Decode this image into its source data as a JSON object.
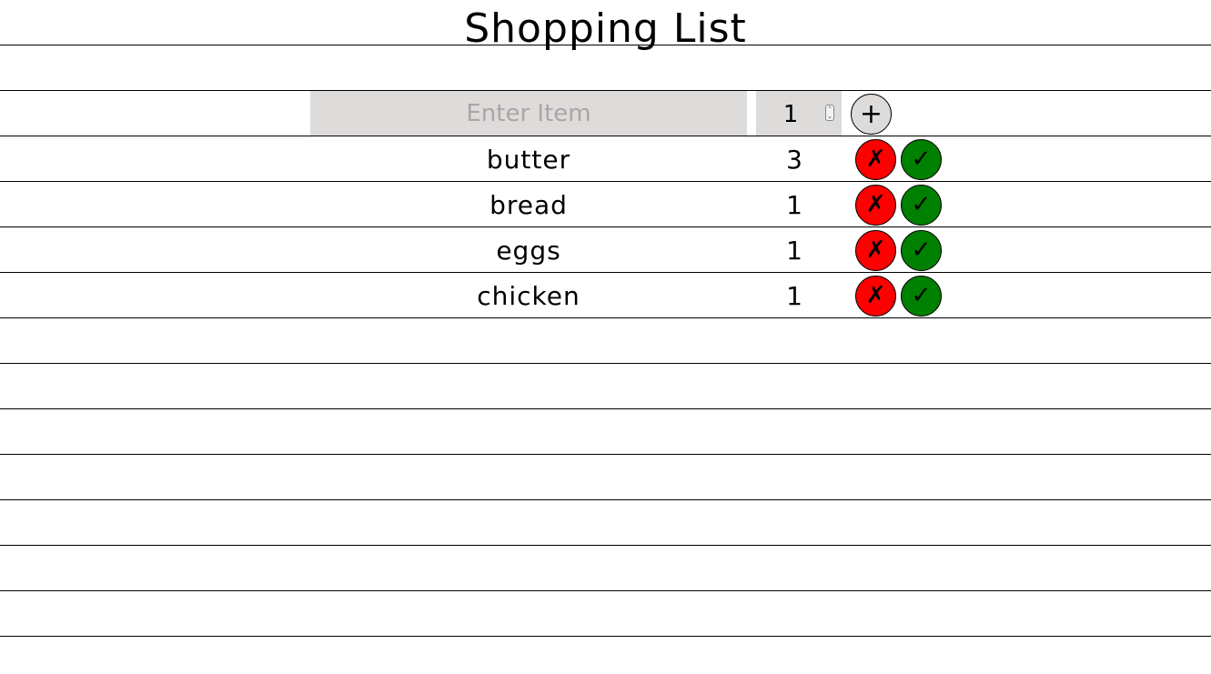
{
  "header": {
    "title": "Shopping List"
  },
  "entry": {
    "placeholder": "Enter Item",
    "quantity": "1",
    "add_label": "+"
  },
  "items": [
    {
      "name": "butter",
      "quantity": "3"
    },
    {
      "name": "bread",
      "quantity": "1"
    },
    {
      "name": "eggs",
      "quantity": "1"
    },
    {
      "name": "chicken",
      "quantity": "1"
    }
  ],
  "controls": {
    "remove_symbol": "✗",
    "done_symbol": "✓",
    "spinner_up": "⌃",
    "spinner_down": "⌄"
  },
  "colors": {
    "remove": "#ff0000",
    "done": "#008000",
    "input_background": "#dedcdb"
  }
}
